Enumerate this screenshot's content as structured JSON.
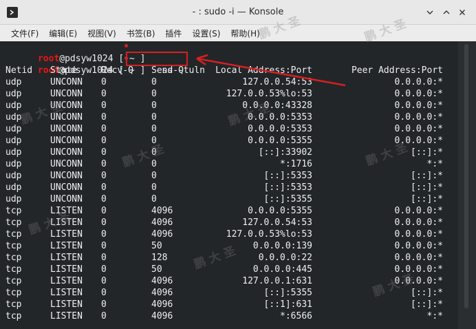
{
  "window": {
    "title": "- : sudo -i — Konsole"
  },
  "menubar": {
    "items": [
      "文件(F)",
      "编辑(E)",
      "视图(V)",
      "书签(B)",
      "插件",
      "设置(S)",
      "帮助(H)"
    ]
  },
  "prompts": [
    {
      "user": "root",
      "host_path": "@pdsyw1024 [ ~ ] ",
      "command": ""
    },
    {
      "user": "root",
      "host_path": "@pdsyw1024 [ ~ ] ",
      "command": "ss -tuln"
    }
  ],
  "header": [
    "Netid",
    "State",
    "Recv-Q",
    "Send-Q",
    "Local Address:Port",
    "Peer Address:Port"
  ],
  "rows": [
    [
      "udp",
      "UNCONN",
      "0",
      "0",
      "127.0.0.54:53",
      "0.0.0.0:*"
    ],
    [
      "udp",
      "UNCONN",
      "0",
      "0",
      "127.0.0.53%lo:53",
      "0.0.0.0:*"
    ],
    [
      "udp",
      "UNCONN",
      "0",
      "0",
      "0.0.0.0:43328",
      "0.0.0.0:*"
    ],
    [
      "udp",
      "UNCONN",
      "0",
      "0",
      "0.0.0.0:5353",
      "0.0.0.0:*"
    ],
    [
      "udp",
      "UNCONN",
      "0",
      "0",
      "0.0.0.0:5353",
      "0.0.0.0:*"
    ],
    [
      "udp",
      "UNCONN",
      "0",
      "0",
      "0.0.0.0:5355",
      "0.0.0.0:*"
    ],
    [
      "udp",
      "UNCONN",
      "0",
      "0",
      "[::]:33902",
      "[::]:*"
    ],
    [
      "udp",
      "UNCONN",
      "0",
      "0",
      "*:1716",
      "*:*"
    ],
    [
      "udp",
      "UNCONN",
      "0",
      "0",
      "[::]:5353",
      "[::]:*"
    ],
    [
      "udp",
      "UNCONN",
      "0",
      "0",
      "[::]:5353",
      "[::]:*"
    ],
    [
      "udp",
      "UNCONN",
      "0",
      "0",
      "[::]:5355",
      "[::]:*"
    ],
    [
      "tcp",
      "LISTEN",
      "0",
      "4096",
      "0.0.0.0:5355",
      "0.0.0.0:*"
    ],
    [
      "tcp",
      "LISTEN",
      "0",
      "4096",
      "127.0.0.54:53",
      "0.0.0.0:*"
    ],
    [
      "tcp",
      "LISTEN",
      "0",
      "4096",
      "127.0.0.53%lo:53",
      "0.0.0.0:*"
    ],
    [
      "tcp",
      "LISTEN",
      "0",
      "50",
      "0.0.0.0:139",
      "0.0.0.0:*"
    ],
    [
      "tcp",
      "LISTEN",
      "0",
      "128",
      "0.0.0.0:22",
      "0.0.0.0:*"
    ],
    [
      "tcp",
      "LISTEN",
      "0",
      "50",
      "0.0.0.0:445",
      "0.0.0.0:*"
    ],
    [
      "tcp",
      "LISTEN",
      "0",
      "4096",
      "127.0.0.1:631",
      "0.0.0.0:*"
    ],
    [
      "tcp",
      "LISTEN",
      "0",
      "4096",
      "[::]:5355",
      "[::]:*"
    ],
    [
      "tcp",
      "LISTEN",
      "0",
      "4096",
      "[::1]:631",
      "[::]:*"
    ],
    [
      "tcp",
      "LISTEN",
      "0",
      "4096",
      "*:6566",
      "*:*"
    ]
  ],
  "watermark": "鹏 大 圣",
  "colors": {
    "terminal_bg": "#232629",
    "terminal_fg": "#eff0f1",
    "prompt_user": "#ed1515",
    "annotation": "#d62020"
  },
  "icons": {
    "app": "konsole-icon",
    "minimize": "chevron-down-icon",
    "maximize": "chevron-up-icon",
    "close": "close-icon"
  }
}
